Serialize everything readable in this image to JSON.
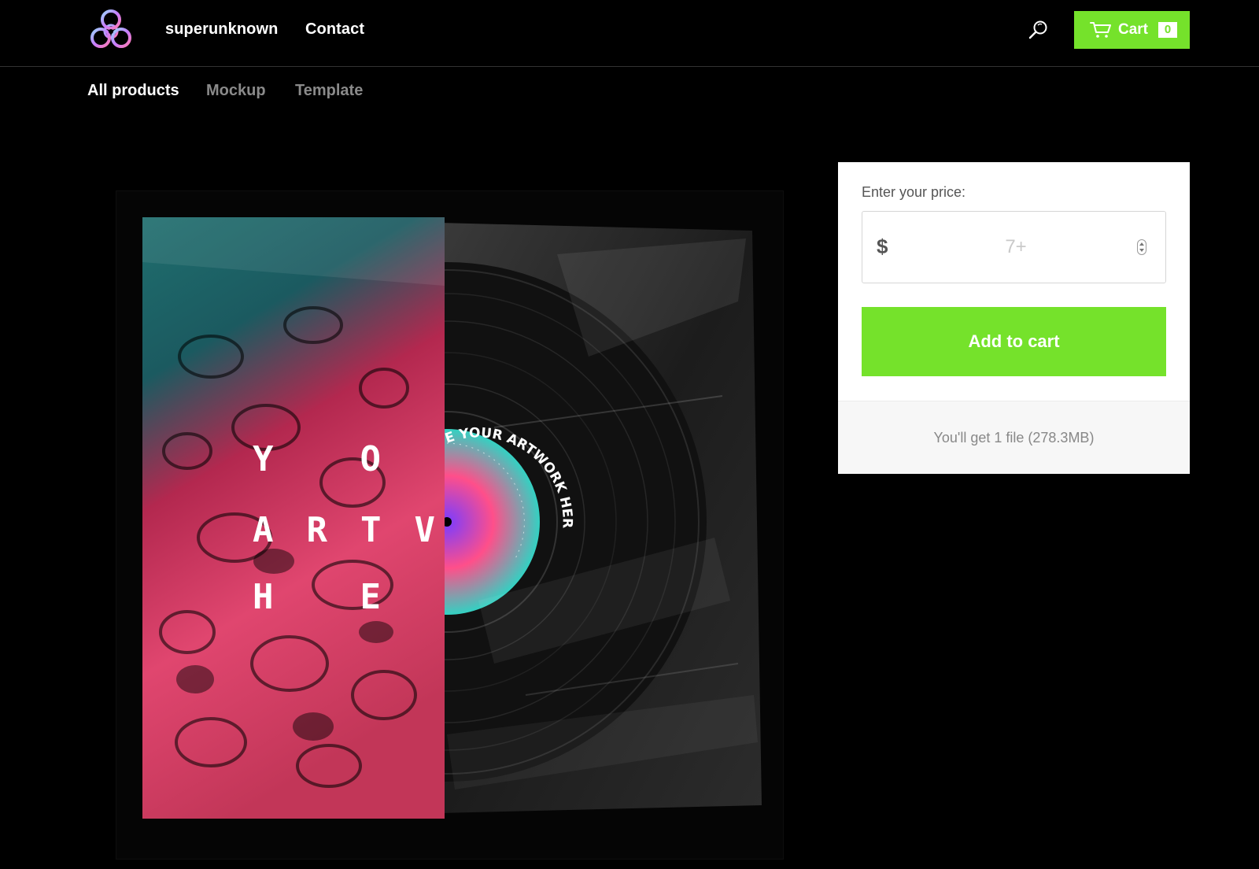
{
  "header": {
    "store_name": "superunknown",
    "contact_label": "Contact",
    "cart": {
      "label": "Cart",
      "count": "0"
    },
    "icons": {
      "logo": "biohazard-logo-icon",
      "search": "search-icon",
      "cart": "cart-icon"
    }
  },
  "categories": {
    "items": [
      {
        "label": "All products",
        "active": true
      },
      {
        "label": "Mockup",
        "active": false
      },
      {
        "label": "Template",
        "active": false
      }
    ]
  },
  "product_image": {
    "cover_text": [
      "YO",
      "ARTV",
      "HE"
    ],
    "label_text": "E YOUR ARTWORK HER"
  },
  "purchase": {
    "price_label": "Enter your price:",
    "currency": "$",
    "price_placeholder": "7+",
    "price_value": "",
    "add_to_cart_label": "Add to cart",
    "file_info": "You'll get 1 file (278.3MB)"
  },
  "colors": {
    "accent": "#75e22b",
    "background": "#000000",
    "inactive_tab": "#8a8a8a"
  }
}
